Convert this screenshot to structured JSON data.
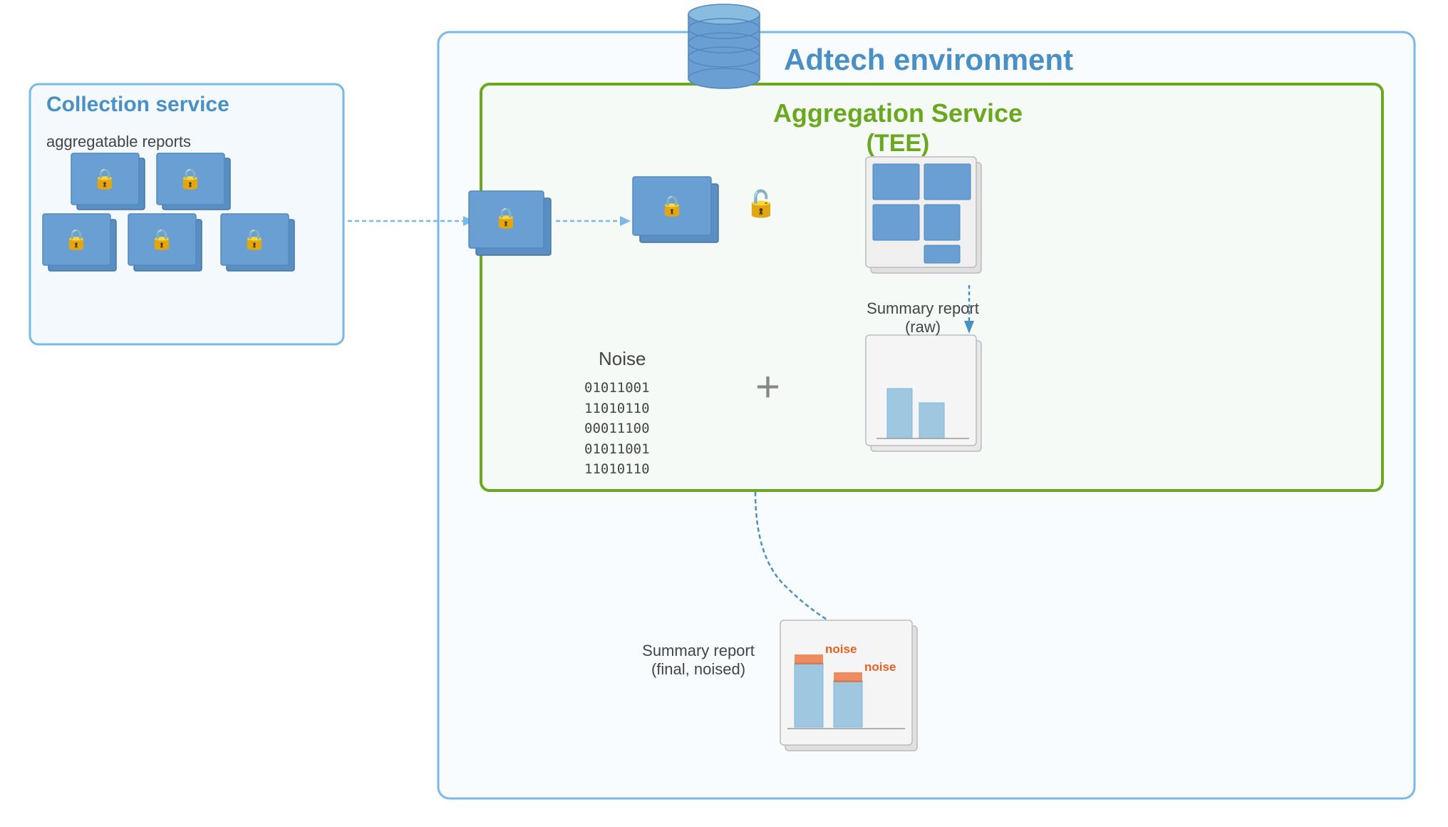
{
  "diagram": {
    "title": "Aggregation Service",
    "adtech_env_label": "Adtech environment",
    "collection_service_label": "Collection service",
    "aggregatable_reports_label": "aggregatable reports",
    "aggregation_service_label": "Aggregation Service",
    "aggregation_service_sublabel": "(TEE)",
    "noise_label": "Noise",
    "noise_binary": "01011001\n11010110\n00011100\n01011001\n11010110",
    "summary_report_raw_label": "Summary report",
    "summary_report_raw_sublabel": "(raw)",
    "summary_report_final_label": "Summary report",
    "summary_report_final_sublabel": "(final, noised)",
    "noise_bar1": "noise",
    "noise_bar2": "noise",
    "colors": {
      "blue_border": "#7ab8e8",
      "blue_dark": "#4a90c4",
      "green_border": "#6aa820",
      "lock_color": "#f5a623",
      "doc_blue": "#6a9fd4",
      "arrow_blue": "#7ab8e8",
      "noise_orange": "#e86020"
    }
  }
}
